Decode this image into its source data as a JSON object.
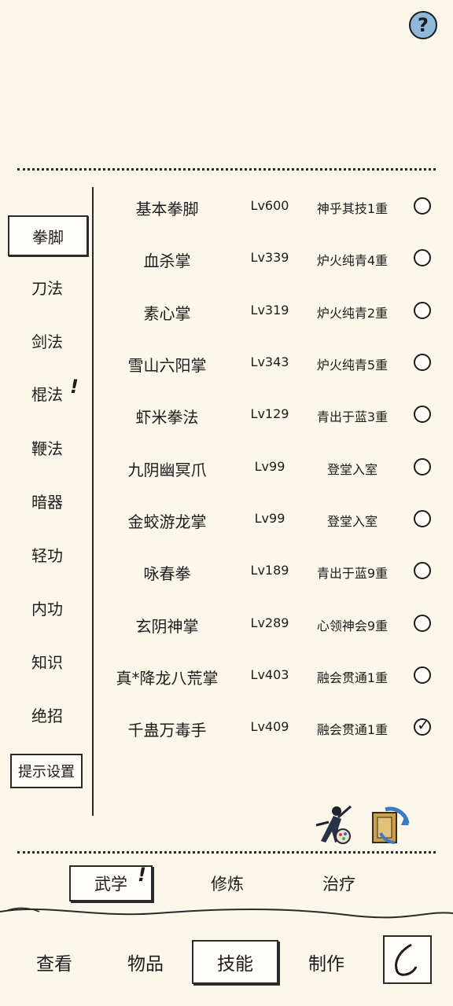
{
  "help": {
    "label": "?"
  },
  "categories": [
    {
      "label": "拳脚",
      "active": true,
      "alert": false
    },
    {
      "label": "刀法",
      "active": false,
      "alert": false
    },
    {
      "label": "剑法",
      "active": false,
      "alert": false
    },
    {
      "label": "棍法",
      "active": false,
      "alert": true
    },
    {
      "label": "鞭法",
      "active": false,
      "alert": false
    },
    {
      "label": "暗器",
      "active": false,
      "alert": false
    },
    {
      "label": "轻功",
      "active": false,
      "alert": false
    },
    {
      "label": "内功",
      "active": false,
      "alert": false
    },
    {
      "label": "知识",
      "active": false,
      "alert": false
    },
    {
      "label": "绝招",
      "active": false,
      "alert": false
    }
  ],
  "alert_mark": "!",
  "hint_settings": "提示设置",
  "skills": [
    {
      "name": "基本拳脚",
      "level": "Lv600",
      "rank": "神乎其技1重",
      "selected": false
    },
    {
      "name": "血杀掌",
      "level": "Lv339",
      "rank": "炉火纯青4重",
      "selected": false
    },
    {
      "name": "素心掌",
      "level": "Lv319",
      "rank": "炉火纯青2重",
      "selected": false
    },
    {
      "name": "雪山六阳掌",
      "level": "Lv343",
      "rank": "炉火纯青5重",
      "selected": false
    },
    {
      "name": "虾米拳法",
      "level": "Lv129",
      "rank": "青出于蓝3重",
      "selected": false
    },
    {
      "name": "九阴幽冥爪",
      "level": "Lv99",
      "rank": "登堂入室",
      "selected": false
    },
    {
      "name": "金蛟游龙掌",
      "level": "Lv99",
      "rank": "登堂入室",
      "selected": false
    },
    {
      "name": "咏春拳",
      "level": "Lv189",
      "rank": "青出于蓝9重",
      "selected": false
    },
    {
      "name": "玄阴神掌",
      "level": "Lv289",
      "rank": "心领神会9重",
      "selected": false
    },
    {
      "name": "真*降龙八荒掌",
      "level": "Lv403",
      "rank": "融会贯通1重",
      "selected": false
    },
    {
      "name": "千蛊万毒手",
      "level": "Lv409",
      "rank": "融会贯通1重",
      "selected": true
    }
  ],
  "tick": "✓",
  "tool_icons": [
    "martial-artist-icon",
    "skill-book-swap-icon"
  ],
  "subtabs": [
    {
      "label": "武学",
      "active": true,
      "alert": true
    },
    {
      "label": "修炼",
      "active": false,
      "alert": false
    },
    {
      "label": "治疗",
      "active": false,
      "alert": false
    }
  ],
  "nav": [
    {
      "label": "查看",
      "active": false
    },
    {
      "label": "物品",
      "active": false
    },
    {
      "label": "技能",
      "active": true
    },
    {
      "label": "制作",
      "active": false
    }
  ],
  "back_icon": "back-arrow-icon"
}
